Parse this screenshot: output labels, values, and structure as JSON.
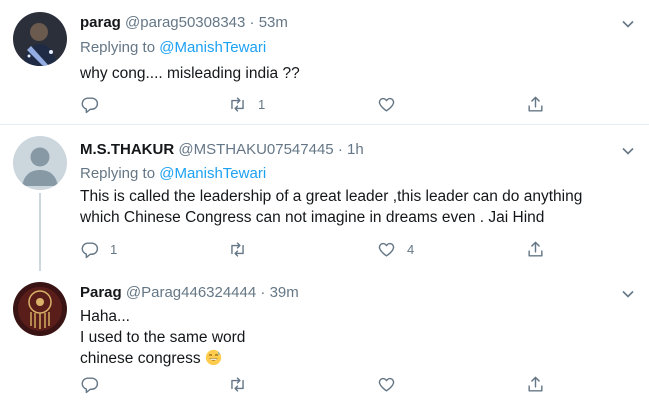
{
  "tweets": [
    {
      "name": "parag",
      "handle": "@parag50308343",
      "time": "53m",
      "replying_prefix": "Replying to ",
      "replying_to": "@ManishTewari",
      "lines": [
        "why cong.... misleading india ??"
      ],
      "replies": "",
      "retweets": "1",
      "likes": ""
    },
    {
      "name": "M.S.THAKUR",
      "handle": "@MSTHAKU07547445",
      "time": "1h",
      "replying_prefix": "Replying to ",
      "replying_to": "@ManishTewari",
      "lines": [
        "This is called the leadership of a great leader ,this leader can do anything",
        "which Chinese Congress can not imagine in dreams even . Jai Hind"
      ],
      "replies": "1",
      "retweets": "",
      "likes": "4"
    },
    {
      "name": "Parag",
      "handle": "@Parag446324444",
      "time": "39m",
      "lines": [
        "Haha...",
        "I used to the same word",
        "chinese congress"
      ],
      "emoji": "😅",
      "replies": "",
      "retweets": "",
      "likes": ""
    }
  ],
  "separator": "·",
  "icons": {
    "reply": "reply-icon",
    "retweet": "retweet-icon",
    "like": "heart-icon",
    "share": "share-icon",
    "menu": "chevron-down-icon"
  },
  "colors": {
    "link": "#1da1f2",
    "muted": "#657786",
    "text": "#14171a",
    "border": "#e6ecf0"
  }
}
